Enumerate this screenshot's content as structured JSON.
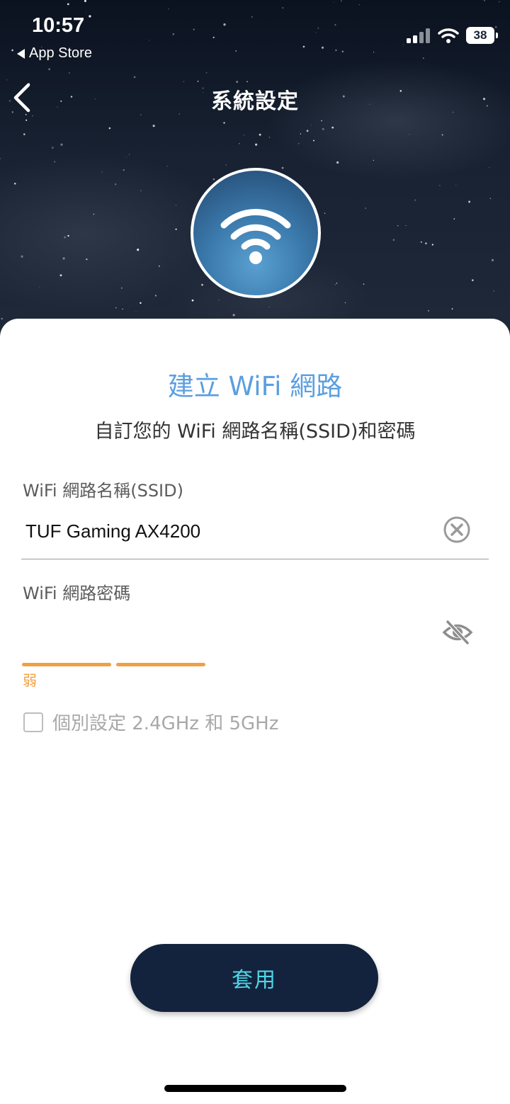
{
  "status_bar": {
    "time": "10:57",
    "back_app": "App Store",
    "battery": "38",
    "icons": [
      "cellular-signal-icon",
      "wifi-status-icon",
      "battery-icon"
    ]
  },
  "nav": {
    "title": "系統設定",
    "back_icon": "chevron-left-icon"
  },
  "hero": {
    "icon": "wifi-icon"
  },
  "form": {
    "title": "建立 WiFi 網路",
    "subtitle": "自訂您的 WiFi 網路名稱(SSID)和密碼",
    "ssid": {
      "label": "WiFi 網路名稱(SSID)",
      "value": "TUF Gaming AX4200",
      "clear_icon": "clear-circle-icon"
    },
    "password": {
      "label": "WiFi 網路密碼",
      "value": "",
      "toggle_icon": "eye-off-icon",
      "strength_text": "弱",
      "strength_color": "#f0a040",
      "strength_segments_filled": 2
    },
    "separate_bands": {
      "label": "個別設定 2.4GHz 和 5GHz",
      "checked": false
    },
    "apply_label": "套用"
  },
  "colors": {
    "title": "#5b9fe0",
    "apply_bg": "#13233d",
    "apply_text": "#4fd6e6"
  }
}
